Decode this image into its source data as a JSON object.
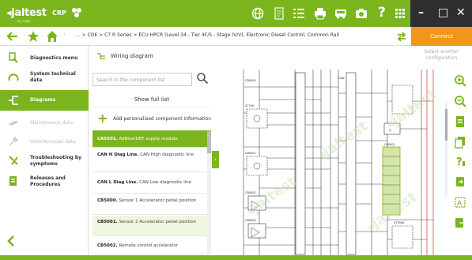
{
  "app": {
    "logo": "◂jaltest",
    "logo_sub": "by cojali",
    "brand": "CRP",
    "accent": "#7ab51d",
    "connect_color": "#f2961b"
  },
  "topbar": {
    "icons": [
      "home-globe-icon",
      "document-icon",
      "list-icon",
      "printer-icon",
      "bus-icon",
      "camera-icon",
      "help-icon"
    ],
    "help_label": "?",
    "minimize_label": "–",
    "maximize_label": "□",
    "close_label": "✕"
  },
  "nav": {
    "breadcrumb": "... > COE > C7 R Series > ECU HPCR (Level 34 - Tier 4F/5 - Stage IV/V), Electronic Diesel Control, Common Rail",
    "connect_label": "Connect",
    "connect_sub": "Select another configuration"
  },
  "sidebar": {
    "items": [
      {
        "label": "Diagnostics menu",
        "icon": "diagnostics-icon",
        "state": "normal"
      },
      {
        "label": "System technical data",
        "icon": "technical-data-icon",
        "state": "normal"
      },
      {
        "label": "Diagrams",
        "icon": "diagrams-icon",
        "state": "active"
      },
      {
        "label": "Maintenance data",
        "icon": "maintenance-icon",
        "state": "disabled"
      },
      {
        "label": "Vehicle/vessel data",
        "icon": "vehicle-data-icon",
        "state": "disabled"
      },
      {
        "label": "Troubleshooting by symptoms",
        "icon": "troubleshooting-icon",
        "state": "normal"
      },
      {
        "label": "Releases and Procedures",
        "icon": "releases-icon",
        "state": "normal"
      }
    ]
  },
  "panel": {
    "title": "Wiring diagram",
    "search_placeholder": "Search in the component list",
    "show_full_label": "Show full list",
    "add_label": "Add personalised component information",
    "components": [
      {
        "code": "CA5501.",
        "desc": " AdBlue/DEF supply module",
        "state": "selected"
      },
      {
        "code": "CAN H Diag Line.",
        "desc": " CAN High diagnostic line",
        "state": "normal"
      },
      {
        "code": "CAN L Diag Line.",
        "desc": " CAN Low diagnostic line",
        "state": "normal"
      },
      {
        "code": "CB5000.",
        "desc": " Sensor 1 Accelerator pedal position",
        "state": "normal"
      },
      {
        "code": "CB5001.",
        "desc": " Sensor 2 Accelerator pedal position",
        "state": "highlight"
      },
      {
        "code": "CB5002.",
        "desc": " Remote control accelerator",
        "state": "normal"
      }
    ],
    "collapse_label": "‹"
  },
  "diagram": {
    "watermark": "◂jaltest",
    "labels": [
      "CB5000",
      "CB5001",
      "CB5002",
      "CB5003",
      "CA5501",
      "S7700",
      "ST3500",
      "CAN",
      "Q"
    ],
    "highlight_color": "#d4e6a5"
  },
  "right_tools": {
    "icons": [
      "zoom-in-icon",
      "zoom-out-icon",
      "pdf-icon",
      "copy-icon",
      "help-info-icon",
      "export-icon",
      "text-icon",
      "exit-icon"
    ]
  }
}
